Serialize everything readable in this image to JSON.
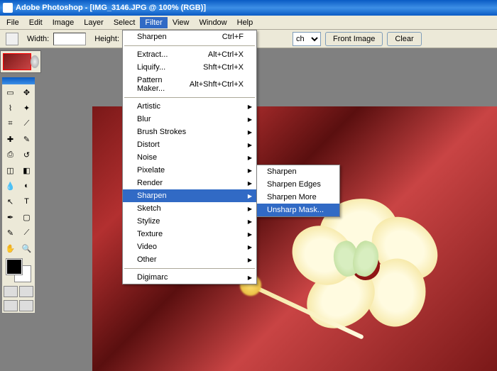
{
  "title": "Adobe Photoshop - [IMG_3146.JPG @ 100% (RGB)]",
  "menubar": [
    "File",
    "Edit",
    "Image",
    "Layer",
    "Select",
    "Filter",
    "View",
    "Window",
    "Help"
  ],
  "menubar_open_index": 5,
  "optionsbar": {
    "width_label": "Width:",
    "height_label": "Height:",
    "front_image": "Front Image",
    "clear": "Clear"
  },
  "filter_menu": {
    "last": {
      "label": "Sharpen",
      "shortcut": "Ctrl+F"
    },
    "extract": {
      "label": "Extract...",
      "shortcut": "Alt+Ctrl+X"
    },
    "liquify": {
      "label": "Liquify...",
      "shortcut": "Shft+Ctrl+X"
    },
    "pattern": {
      "label": "Pattern Maker...",
      "shortcut": "Alt+Shft+Ctrl+X"
    },
    "groups": [
      "Artistic",
      "Blur",
      "Brush Strokes",
      "Distort",
      "Noise",
      "Pixelate",
      "Render",
      "Sharpen",
      "Sketch",
      "Stylize",
      "Texture",
      "Video",
      "Other"
    ],
    "digimarc": "Digimarc",
    "highlighted_group_index": 7
  },
  "sharpen_submenu": {
    "items": [
      "Sharpen",
      "Sharpen Edges",
      "Sharpen More",
      "Unsharp Mask..."
    ],
    "highlighted_index": 3
  },
  "tools": [
    "marquee",
    "move",
    "lasso",
    "wand",
    "crop",
    "slice",
    "heal",
    "brush",
    "stamp",
    "history",
    "eraser",
    "gradient",
    "blur",
    "dodge",
    "path",
    "type",
    "pen",
    "shape",
    "notes",
    "eyedrop",
    "hand",
    "zoom"
  ]
}
